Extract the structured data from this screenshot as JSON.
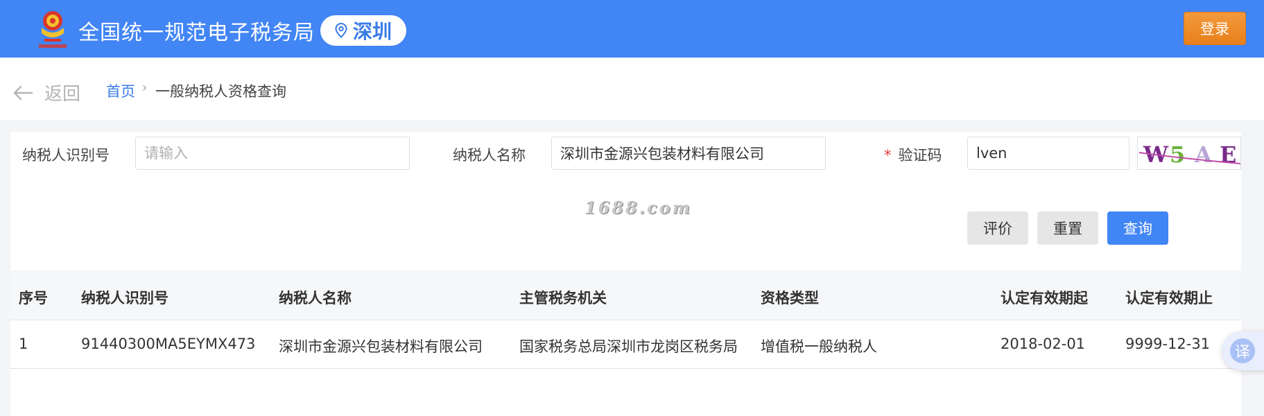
{
  "header": {
    "site_title": "全国统一规范电子税务局",
    "city": "深圳",
    "login_label": "登录",
    "emblem_icon": "national-tax-emblem-icon",
    "location_icon": "location-pin-icon"
  },
  "breadcrumb": {
    "back_label": "返回",
    "home": "首页",
    "separator": "›",
    "current": "一般纳税人资格查询"
  },
  "form": {
    "taxpayer_id_label": "纳税人识别号",
    "taxpayer_id_value": "",
    "taxpayer_id_placeholder": "请输入",
    "taxpayer_name_label": "纳税人名称",
    "taxpayer_name_value": "深圳市金源兴包装材料有限公司",
    "captcha_label": "验证码",
    "captcha_required_mark": "*",
    "captcha_value": "lven",
    "captcha_image_text": "W5AE"
  },
  "watermark": "1688.com",
  "buttons": {
    "evaluate": "评价",
    "reset": "重置",
    "query": "查询"
  },
  "table": {
    "columns": [
      "序号",
      "纳税人识别号",
      "纳税人名称",
      "主管税务机关",
      "资格类型",
      "认定有效期起",
      "认定有效期止"
    ],
    "rows": [
      [
        "1",
        "91440300MA5EYMX473",
        "深圳市金源兴包装材料有限公司",
        "国家税务总局深圳市龙岗区税务局",
        "增值税一般纳税人",
        "2018-02-01",
        "9999-12-31"
      ]
    ]
  },
  "translate_fab": {
    "label": "译"
  },
  "colors": {
    "header_bg": "#4285f4",
    "login_btn": "#ef8c2a",
    "primary": "#4285f4",
    "link": "#3a7be8"
  }
}
